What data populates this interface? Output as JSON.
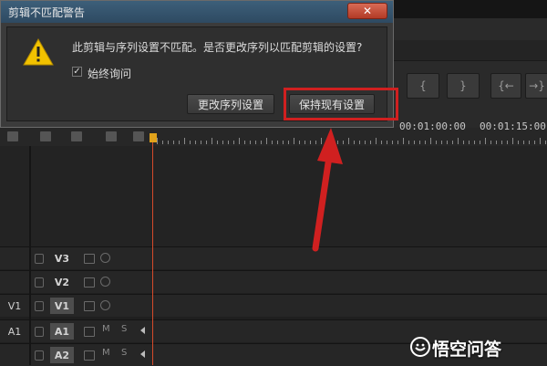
{
  "dialog": {
    "title": "剪辑不匹配警告",
    "close_label": "✕",
    "message": "此剪辑与序列设置不匹配。是否更改序列以匹配剪辑的设置?",
    "checkbox_label": "始终询问",
    "checkbox_checked": true,
    "change_button": "更改序列设置",
    "keep_button": "保持现有设置"
  },
  "timeline": {
    "timecode_1": "00:01:00:00",
    "timecode_2": "00:01:15:00",
    "nav_buttons": [
      "{",
      "}",
      "{←",
      "→}"
    ],
    "tracks": [
      {
        "source": "",
        "name": "V3",
        "highlight": false,
        "type": "video"
      },
      {
        "source": "",
        "name": "V2",
        "highlight": false,
        "type": "video"
      },
      {
        "source": "V1",
        "name": "V1",
        "highlight": true,
        "type": "video"
      },
      {
        "source": "A1",
        "name": "A1",
        "highlight": true,
        "type": "audio"
      },
      {
        "source": "",
        "name": "A2",
        "highlight": true,
        "type": "audio"
      }
    ],
    "audio_m": "M",
    "audio_s": "S"
  },
  "watermark": {
    "text": "悟空问答"
  },
  "colors": {
    "annotation_red": "#d02020",
    "playhead": "#e0a21b",
    "titlebar": "#3d5f7a"
  }
}
